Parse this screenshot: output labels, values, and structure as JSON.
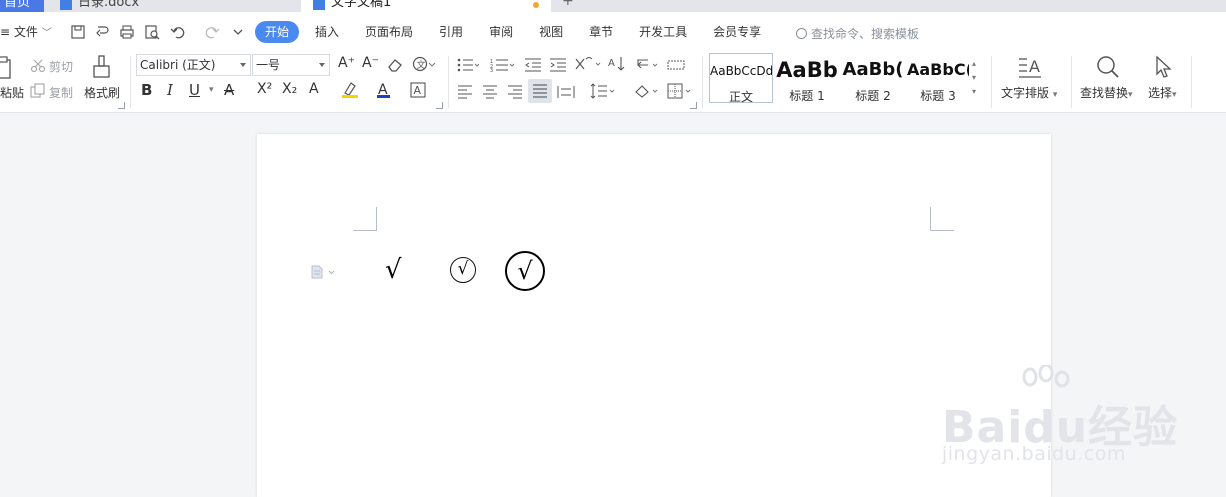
{
  "tabs": [
    {
      "label": "首页"
    },
    {
      "label": "日录.docx"
    },
    {
      "label": "文字文稿1"
    }
  ],
  "menu": {
    "file_label": "文件",
    "tabs": [
      "开始",
      "插入",
      "页面布局",
      "引用",
      "审阅",
      "视图",
      "章节",
      "开发工具",
      "会员专享"
    ],
    "search_placeholder": "查找命令、搜索模板"
  },
  "ribbon": {
    "paste_label": "粘贴",
    "cut_label": "剪切",
    "copy_label": "复制",
    "format_painter_label": "格式刷",
    "font_name": "Calibri (正文)",
    "font_size": "一号",
    "styles": [
      {
        "sample": "AaBbCcDd",
        "name": "正文"
      },
      {
        "sample": "AaBb",
        "name": "标题 1"
      },
      {
        "sample": "AaBb(",
        "name": "标题 2"
      },
      {
        "sample": "AaBbC(",
        "name": "标题 3"
      }
    ],
    "text_layout_label": "文字排版",
    "find_replace_label": "查找替换",
    "select_label": "选择"
  },
  "document": {
    "check_plain": "√",
    "check_small": "√",
    "check_big": "√"
  },
  "watermark": {
    "brand": "Baidu经验",
    "url": "jingyan.baidu.com"
  },
  "colors": {
    "accent": "#4a89f0",
    "home_tab": "#4a78e6",
    "highlight_yellow": "#f5d400",
    "font_color_blue": "#1f3fbf"
  }
}
